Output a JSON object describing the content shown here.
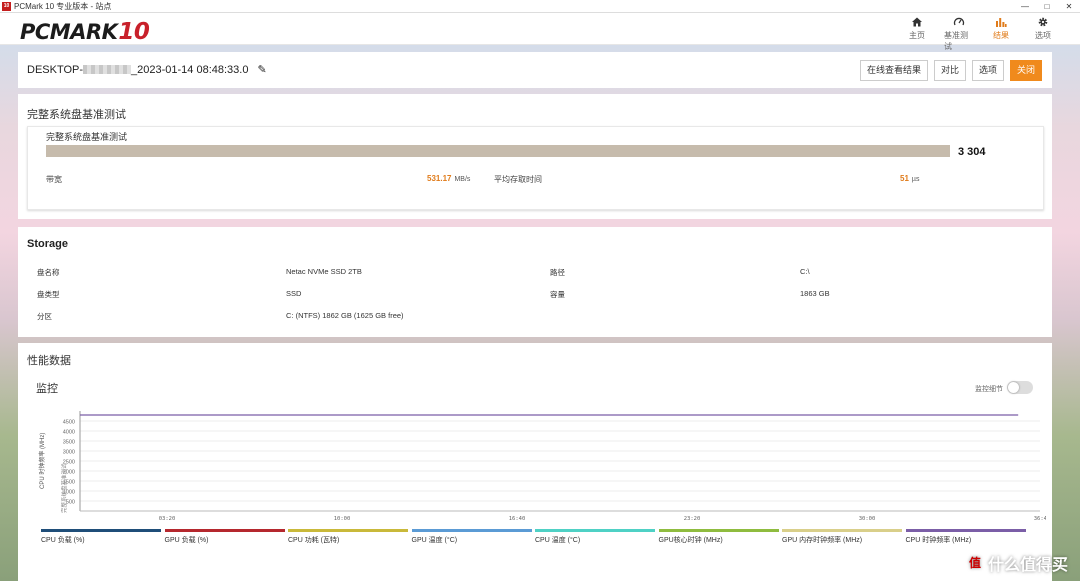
{
  "window": {
    "title": "PCMark 10 专业版本 - 站点",
    "app_badge": "10",
    "minimize": "—",
    "maximize": "□",
    "close": "✕"
  },
  "header": {
    "logo_main": "PCMARK",
    "logo_num": "10",
    "nav": [
      {
        "label": "主页",
        "icon": "home-icon"
      },
      {
        "label": "基准测试",
        "icon": "gauge-icon"
      },
      {
        "label": "结果",
        "icon": "bar-chart-icon",
        "active": true
      },
      {
        "label": "选项",
        "icon": "gear-icon"
      }
    ]
  },
  "result": {
    "title_prefix": "DESKTOP-",
    "title_suffix": "_2023-01-14 08:48:33.0",
    "buttons": {
      "online": "在线查看结果",
      "compare": "对比",
      "options": "选项",
      "close": "关闭"
    }
  },
  "test": {
    "section_title": "完整系统盘基准测试",
    "card_title": "完整系统盘基准测试",
    "score": "3 304",
    "bandwidth_label": "带宽",
    "bandwidth_value": "531.17",
    "bandwidth_unit": "MB/s",
    "latency_label": "平均存取时间",
    "latency_value": "51",
    "latency_unit": "µs"
  },
  "storage": {
    "section_title": "Storage",
    "rows": [
      {
        "k1": "盘名称",
        "v1": "Netac NVMe SSD 2TB",
        "k2": "路径",
        "v2": "C:\\"
      },
      {
        "k1": "盘类型",
        "v1": "SSD",
        "k2": "容量",
        "v2": "1863 GB"
      },
      {
        "k1": "分区",
        "v1": "C: (NTFS) 1862 GB (1625 GB free)",
        "k2": "",
        "v2": ""
      }
    ]
  },
  "perf": {
    "section_title": "性能数据",
    "monitor_title": "监控",
    "toggle_label": "监控细节"
  },
  "chart_data": {
    "type": "line",
    "ylabel": "CPU 时钟频率 (MHz)",
    "ylabel2": "完整系统盘基准测试",
    "yticks": [
      500,
      1000,
      1500,
      2000,
      2500,
      3000,
      3500,
      4000,
      4500
    ],
    "ylim": [
      0,
      5000
    ],
    "xticks": [
      "03:20",
      "10:00",
      "16:40",
      "23:20",
      "30:00",
      "36:40"
    ],
    "xlim_seconds": [
      0,
      2200
    ],
    "series": [
      {
        "name": "CPU 时钟频率 (MHz)",
        "color": "#7b5ea7",
        "x": [
          0,
          2150
        ],
        "y": [
          4800,
          4800
        ]
      }
    ],
    "legend": [
      {
        "name": "CPU 负载 (%)",
        "color": "#1f4e79"
      },
      {
        "name": "GPU 负载 (%)",
        "color": "#b5282e"
      },
      {
        "name": "CPU 功耗 (瓦特)",
        "color": "#c9b93a"
      },
      {
        "name": "GPU 温度 (°C)",
        "color": "#5b9bd5"
      },
      {
        "name": "CPU 温度 (°C)",
        "color": "#4fd1c5"
      },
      {
        "name": "GPU核心时钟 (MHz)",
        "color": "#8fbc3f"
      },
      {
        "name": "GPU 内存时钟频率 (MHz)",
        "color": "#d9cf8a"
      },
      {
        "name": "CPU 时钟频率 (MHz)",
        "color": "#7b5ea7"
      }
    ]
  },
  "watermark": {
    "icon": "值",
    "text": "什么值得买"
  }
}
